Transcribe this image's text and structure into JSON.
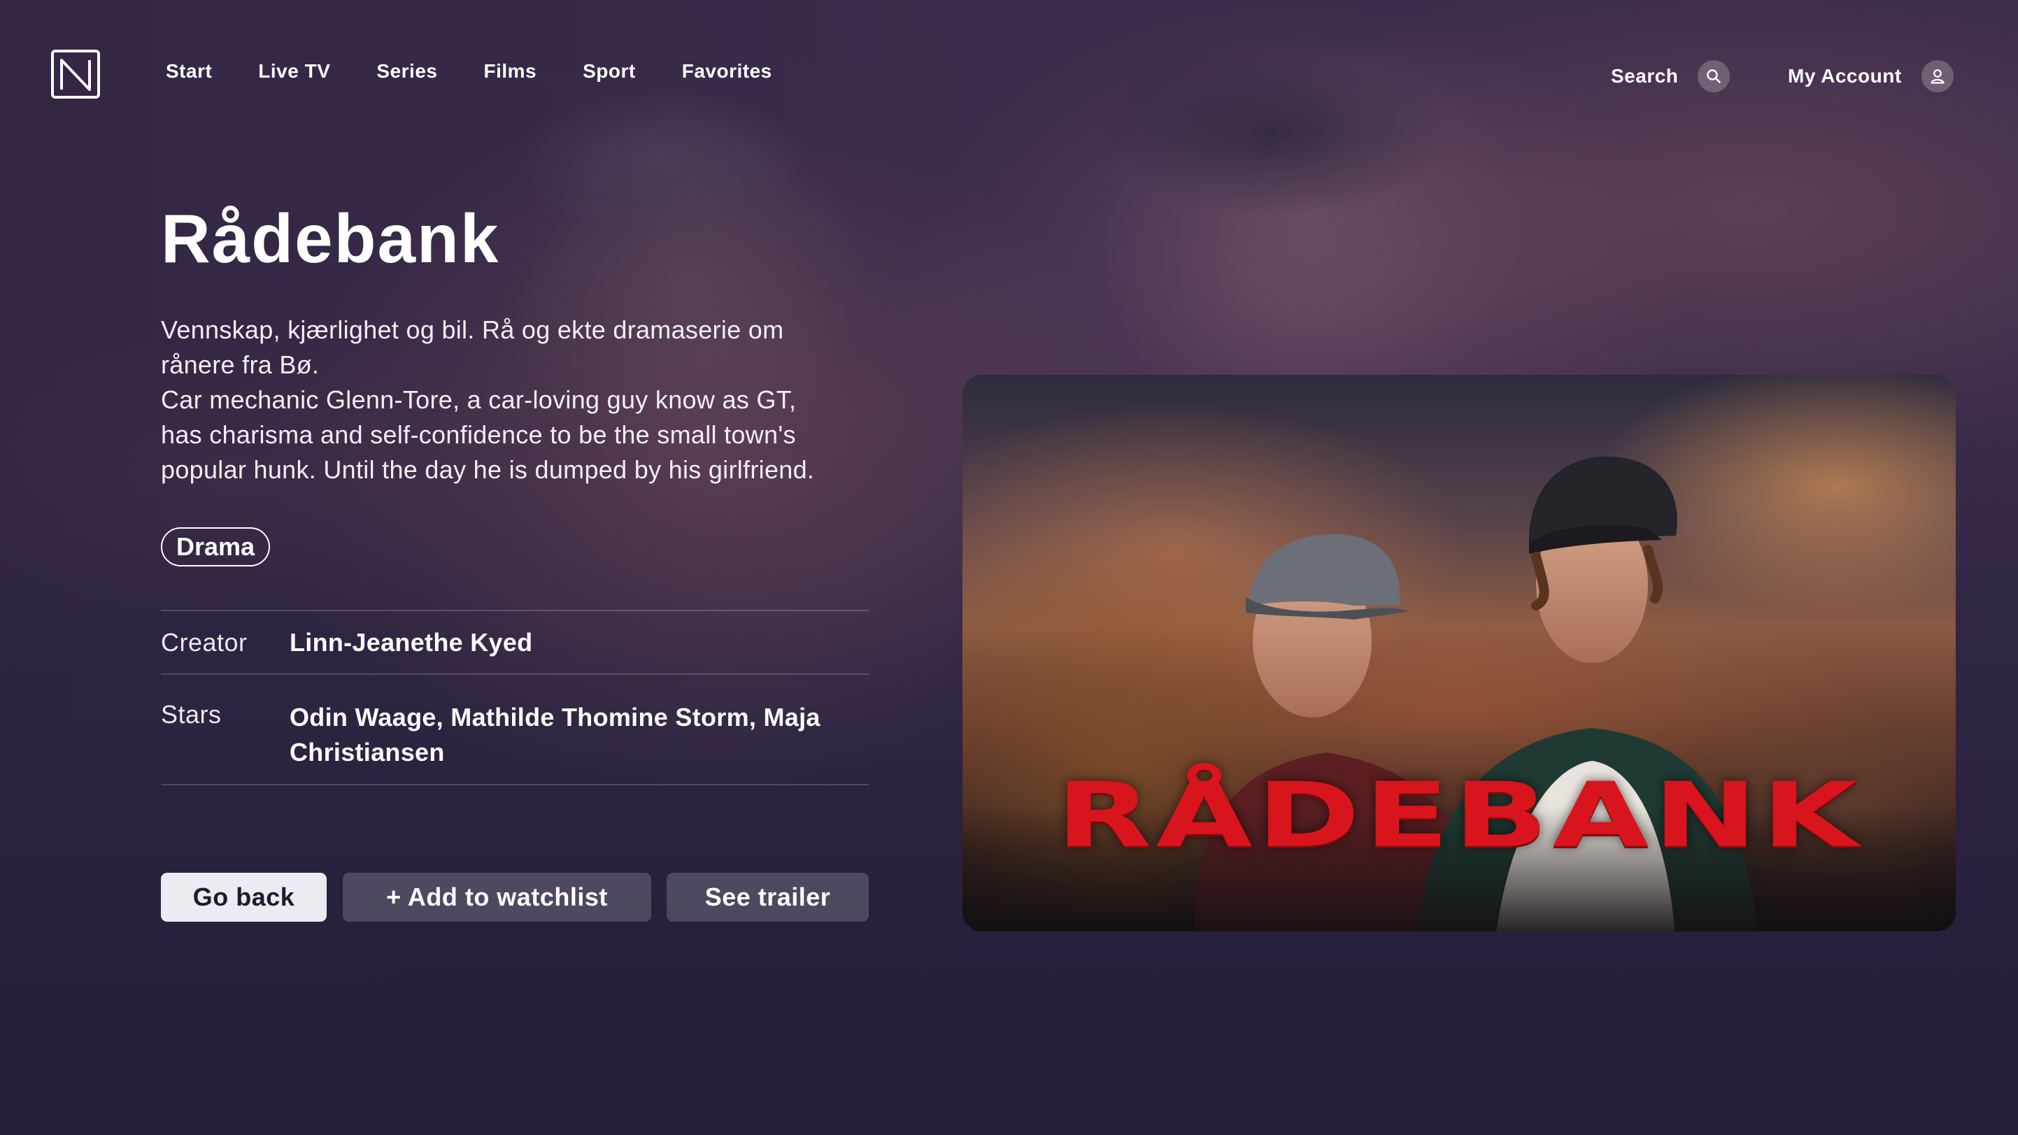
{
  "nav": {
    "logo_icon": "n-logo-icon",
    "items": [
      "Start",
      "Live TV",
      "Series",
      "Films",
      "Sport",
      "Favorites"
    ]
  },
  "header_right": {
    "search_label": "Search",
    "search_icon": "search-icon",
    "account_label": "My Account",
    "account_icon": "user-icon"
  },
  "show": {
    "title": "Rådebank",
    "description_lines": [
      "Vennskap, kjærlighet og bil. Rå og ekte dramaserie om",
      "rånere fra Bø.",
      "Car mechanic Glenn-Tore, a car-loving guy know as GT,",
      "has charisma and self-confidence to be the small town's",
      "popular hunk. Until the day he is dumped by his girlfriend."
    ],
    "genre": "Drama",
    "creator_label": "Creator",
    "creator": "Linn-Jeanethe Kyed",
    "stars_label": "Stars",
    "stars_lines": [
      "Odin Waage, Mathilde Thomine Storm, Maja",
      "Christiansen"
    ]
  },
  "actions": {
    "back": "Go back",
    "watchlist": "+ Add to watchlist",
    "trailer": "See trailer"
  },
  "poster": {
    "title_text": "RÅDEBANK"
  },
  "colors": {
    "background": "#2a2341",
    "poster_title_red": "#d8141c",
    "primary_button_bg": "#ecebf1"
  }
}
